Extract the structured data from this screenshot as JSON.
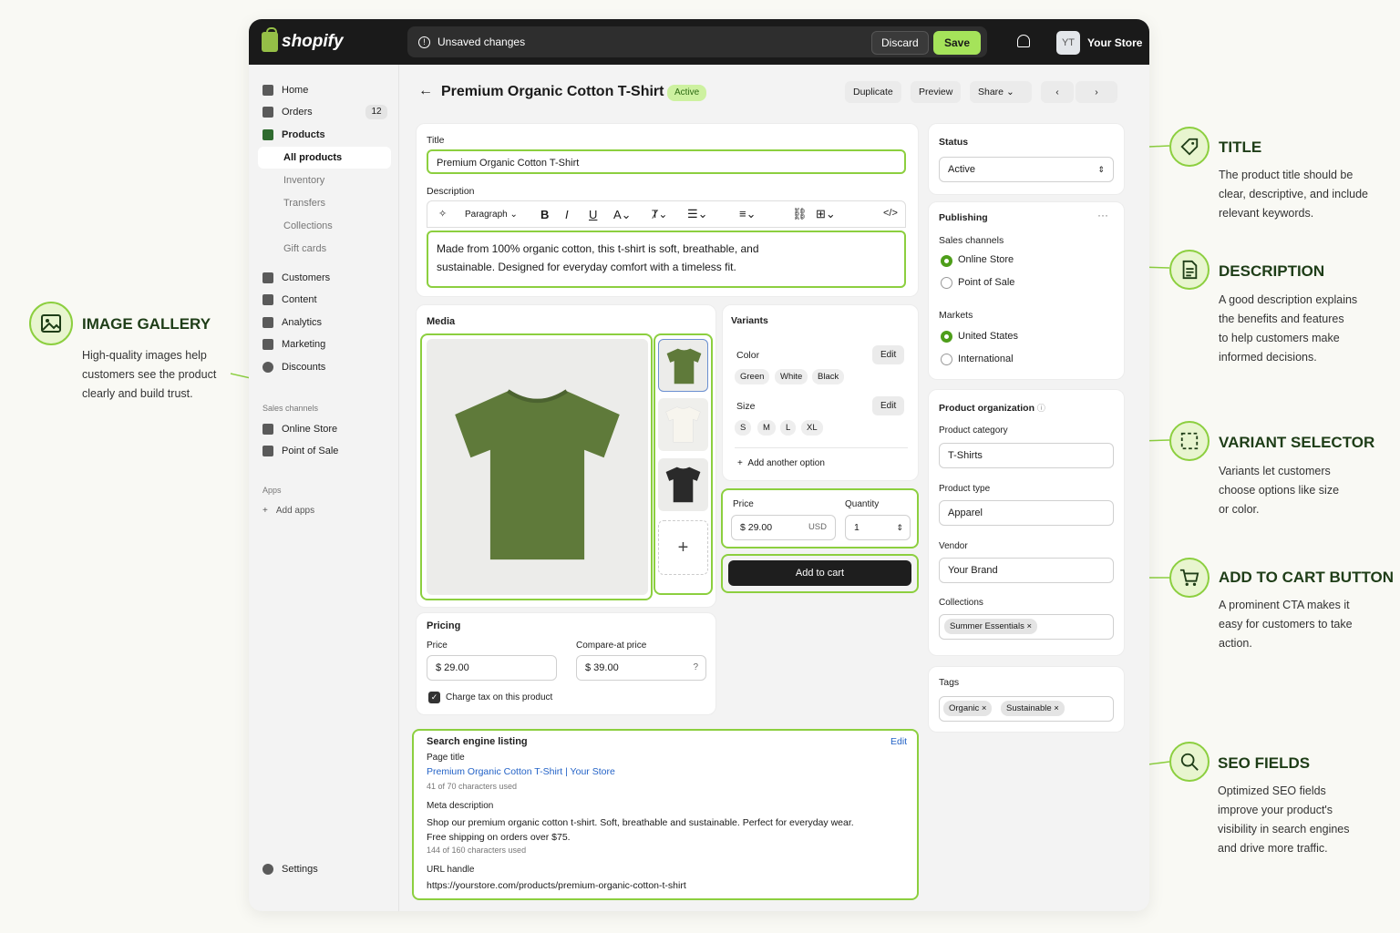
{
  "topbar": {
    "logo": "shopify",
    "unsaved": "Unsaved changes",
    "discard": "Discard",
    "save": "Save",
    "avatar": "YT",
    "store": "Your Store"
  },
  "sidebar": {
    "items": [
      "Home",
      "Orders",
      "Products",
      "All products",
      "Inventory",
      "Transfers",
      "Collections",
      "Gift cards",
      "Customers",
      "Content",
      "Analytics",
      "Marketing",
      "Discounts"
    ],
    "orders_badge": "12",
    "sales_channels": "Sales channels",
    "channels": [
      "Online Store",
      "Point of Sale"
    ],
    "apps": "Apps",
    "add_apps": "Add apps",
    "settings": "Settings"
  },
  "header": {
    "title": "Premium Organic Cotton T-Shirt",
    "status": "Active",
    "duplicate": "Duplicate",
    "preview": "Preview",
    "share": "Share"
  },
  "title_card": {
    "title_label": "Title",
    "title_value": "Premium Organic Cotton T-Shirt",
    "desc_label": "Description",
    "paragraph": "Paragraph",
    "desc_text": "Made from 100% organic cotton, this t-shirt is soft, breathable, and sustainable. Designed for everyday comfort with a timeless fit."
  },
  "media": {
    "label": "Media"
  },
  "variants": {
    "label": "Variants",
    "color": "Color",
    "edit": "Edit",
    "colors": [
      "Green",
      "White",
      "Black"
    ],
    "size": "Size",
    "sizes": [
      "S",
      "M",
      "L",
      "XL"
    ],
    "add_option": "Add another option",
    "price": "Price",
    "price_value": "$  29.00",
    "usd": "USD",
    "quantity": "Quantity",
    "qty_value": "1",
    "add_to_cart": "Add to cart"
  },
  "pricing": {
    "label": "Pricing",
    "price": "Price",
    "price_value": "$  29.00",
    "compare": "Compare-at price",
    "compare_value": "$  39.00",
    "tax": "Charge tax on this product"
  },
  "seo": {
    "label": "Search engine listing",
    "edit": "Edit",
    "page_title": "Page title",
    "title_link": "Premium Organic Cotton T-Shirt | Your Store",
    "title_count": "41 of 70 characters used",
    "meta": "Meta description",
    "meta_text": "Shop our premium organic cotton t-shirt. Soft, breathable and sustainable. Perfect for everyday wear. Free shipping on orders over $75.",
    "meta_count": "144 of 160 characters used",
    "url": "URL handle",
    "url_value": "https://yourstore.com/products/premium-organic-cotton-t-shirt"
  },
  "status_card": {
    "label": "Status",
    "value": "Active"
  },
  "publishing": {
    "label": "Publishing",
    "sales": "Sales channels",
    "online": "Online Store",
    "pos": "Point of Sale",
    "markets": "Markets",
    "us": "United States",
    "intl": "International"
  },
  "org": {
    "label": "Product organization",
    "category": "Product category",
    "category_value": "T-Shirts",
    "type": "Product type",
    "type_value": "Apparel",
    "vendor": "Vendor",
    "vendor_value": "Your Brand",
    "collections": "Collections",
    "collection_tag": "Summer Essentials",
    "tags": "Tags",
    "tag_list": [
      "Organic",
      "Sustainable"
    ]
  },
  "annotations": {
    "gallery": {
      "title": "IMAGE GALLERY",
      "body": [
        "High-quality images help",
        "customers see the product",
        "clearly and build trust."
      ]
    },
    "title": {
      "title": "TITLE",
      "body": [
        "The product title should be",
        "clear, descriptive, and include",
        "relevant keywords."
      ]
    },
    "description": {
      "title": "DESCRIPTION",
      "body": [
        "A good description explains",
        "the benefits and features",
        "to help customers make",
        "informed decisions."
      ]
    },
    "variant": {
      "title": "VARIANT SELECTOR",
      "body": [
        "Variants let customers",
        "choose options like size",
        "or color."
      ]
    },
    "cart": {
      "title": "ADD TO CART BUTTON",
      "body": [
        "A prominent CTA makes it",
        "easy for customers to take",
        "action."
      ]
    },
    "seo": {
      "title": "SEO FIELDS",
      "body": [
        "Optimized SEO fields",
        "improve your product's",
        "visibility in search engines",
        "and drive more traffic."
      ]
    }
  },
  "colors": {
    "accent": "#8ccf3f",
    "brand": "#95bf47",
    "dark": "#1a1a1a",
    "shirt_green": "#5f7a3a"
  }
}
